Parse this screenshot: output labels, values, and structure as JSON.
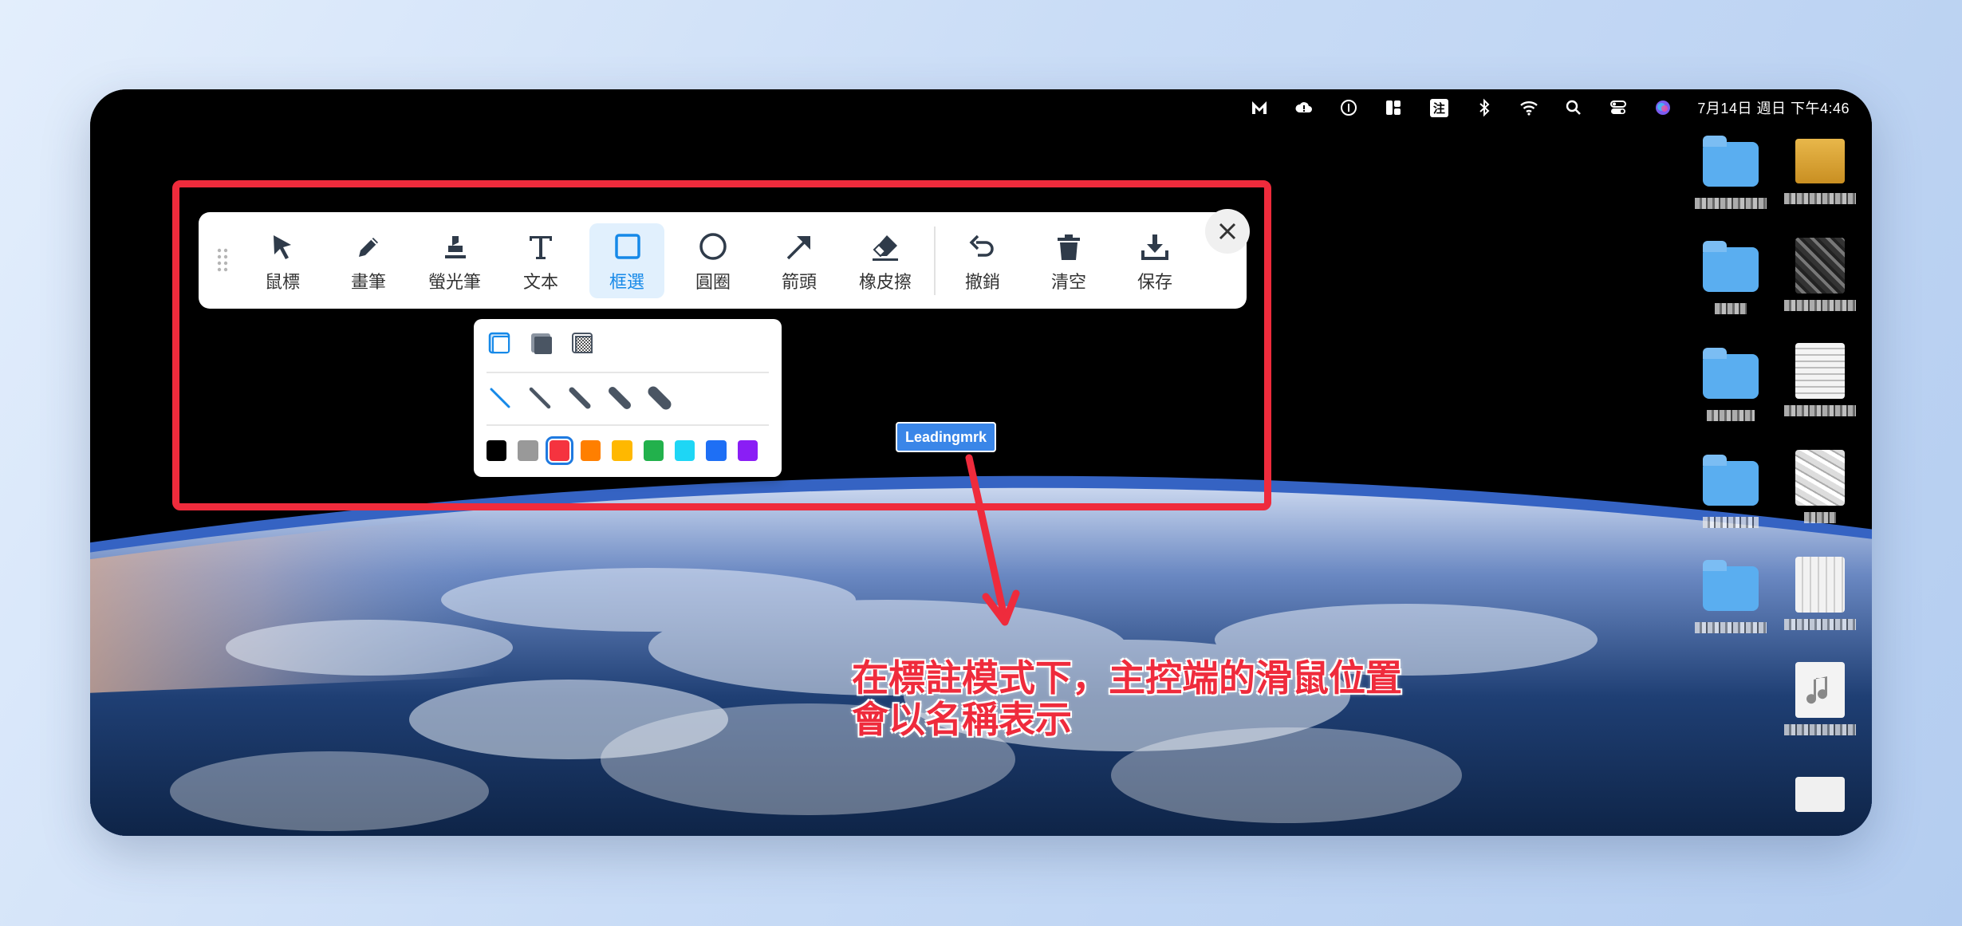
{
  "menubar": {
    "icons": [
      "m-app-icon",
      "cloud-alert-icon",
      "circle-one-icon",
      "grid-app-icon",
      "note-badge-icon",
      "bluetooth-icon",
      "wifi-icon",
      "search-icon",
      "control-center-icon",
      "siri-icon"
    ],
    "note_badge_label": "注",
    "clock": "7月14日 週日 下午4:46"
  },
  "toolbar": {
    "tools": [
      {
        "id": "cursor",
        "label": "鼠標",
        "icon": "pointer-icon"
      },
      {
        "id": "pen",
        "label": "畫筆",
        "icon": "pencil-icon"
      },
      {
        "id": "highlighter",
        "label": "螢光筆",
        "icon": "highlighter-icon"
      },
      {
        "id": "text",
        "label": "文本",
        "icon": "text-icon"
      },
      {
        "id": "rect",
        "label": "框選",
        "icon": "square-icon",
        "active": true
      },
      {
        "id": "circle",
        "label": "圓圈",
        "icon": "circle-icon"
      },
      {
        "id": "arrow",
        "label": "箭頭",
        "icon": "arrow-icon"
      },
      {
        "id": "eraser",
        "label": "橡皮擦",
        "icon": "eraser-icon"
      },
      {
        "id": "undo",
        "label": "撤銷",
        "icon": "undo-icon"
      },
      {
        "id": "clear",
        "label": "清空",
        "icon": "trash-icon"
      },
      {
        "id": "save",
        "label": "保存",
        "icon": "download-icon"
      }
    ],
    "active_color": "#1689e8"
  },
  "subpanel": {
    "fill_options": [
      "outline-fill-icon",
      "solid-fill-icon",
      "pattern-fill-icon"
    ],
    "selected_fill": "outline-fill-icon",
    "stroke_widths": [
      "width-1",
      "width-2",
      "width-3",
      "width-4",
      "width-5"
    ],
    "selected_width": "width-1",
    "colors": [
      "#000000",
      "#999999",
      "#f5333f",
      "#ff7f00",
      "#ffb800",
      "#22b14c",
      "#1ed6f5",
      "#1e6ff5",
      "#8a1ef5"
    ],
    "selected_color": "#f5333f"
  },
  "cursor_tag": "Leadingmrk",
  "caption": {
    "line1": "在標註模式下，主控端的滑鼠位置",
    "line2": "會以名稱表示"
  },
  "annotation_color": "#ef2b3c"
}
